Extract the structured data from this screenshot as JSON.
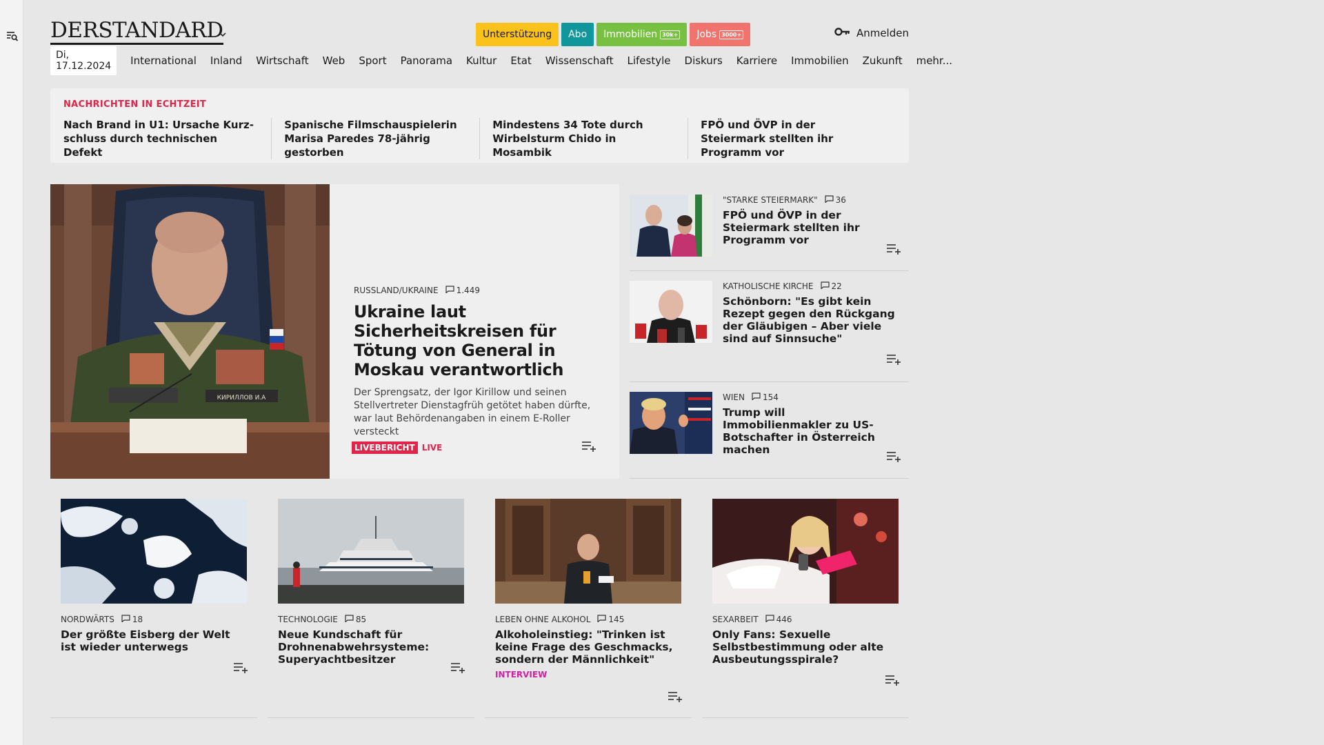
{
  "sidebar": {
    "menu_icon": "search-menu-icon"
  },
  "header": {
    "logo": "DERSTANDARD",
    "promo": {
      "support": "Unterstützung",
      "abo": "Abo",
      "immobilien": "Immobilien",
      "immobilien_badge": "30k+",
      "jobs": "Jobs",
      "jobs_badge": "3000+"
    },
    "login": "Anmelden",
    "colors": {
      "support": "#fbc21c",
      "abo": "#11969b",
      "immobilien": "#77c042",
      "jobs": "#f0746d",
      "accent": "#e0254a"
    }
  },
  "nav": {
    "date": "Di, 17.12.2024",
    "items": [
      "International",
      "Inland",
      "Wirtschaft",
      "Web",
      "Sport",
      "Panorama",
      "Kultur",
      "Etat",
      "Wissenschaft",
      "Lifestyle",
      "Diskurs",
      "Karriere",
      "Immobilien",
      "Zukunft",
      "mehr..."
    ]
  },
  "ticker": {
    "label": "NACHRICHTEN IN ECHTZEIT",
    "items": [
      "Nach Brand in U1: Ursache Kurz­schluss durch technischen Defekt",
      "Spanische Filmschauspielerin Marisa Paredes 78-jährig gestorben",
      "Mindestens 34 Tote durch Wirbel­sturm Chido in Mosambik",
      "FPÖ und ÖVP in der Steiermark stell­ten ihr Programm vor"
    ]
  },
  "lead": {
    "kicker": "RUSSLAND/UKRAINE",
    "comments": "1.449",
    "title": "Ukraine laut Sicherheitskrei­sen für Tötung von General in Moskau verantwortlich",
    "teaser": "Der Sprengsatz, der Igor Kirillow und seinen Stellvertreter Dienstagfrüh getötet haben dürfte, war laut Behördenangaben in einem E-Roller versteckt",
    "badge": "LIVEBERICHT",
    "live": "LIVE",
    "nameplate": "КИРИЛЛОВ И.А"
  },
  "side": [
    {
      "kicker": "\"STARKE STEIERMARK\"",
      "comments": "36",
      "title": "FPÖ und ÖVP in der Steiermark stellten ihr Programm vor"
    },
    {
      "kicker": "KATHOLISCHE KIRCHE",
      "comments": "22",
      "title": "Schönborn: \"Es gibt kein Rezept gegen den Rückgang der Gläubigen – Aber viele sind auf Sinnsuche\""
    },
    {
      "kicker": "WIEN",
      "comments": "154",
      "title": "Trump will Immobilienmakler zu US-Botschafter in Österreich machen"
    }
  ],
  "cards": [
    {
      "kicker": "NORDWÄRTS",
      "comments": "18",
      "title": "Der größte Eisberg der Welt ist wieder unterwegs"
    },
    {
      "kicker": "TECHNOLOGIE",
      "comments": "85",
      "title": "Neue Kundschaft für Drohnenab­wehrsysteme: Superyachtbesitzer"
    },
    {
      "kicker": "LEBEN OHNE ALKOHOL",
      "comments": "145",
      "title": "Alkoholeinstieg: \"Trinken ist keine Frage des Geschmacks, sondern der Männlichkeit\"",
      "tag": "INTERVIEW"
    },
    {
      "kicker": "SEXARBEIT",
      "comments": "446",
      "title": "Only Fans: Sexuelle Selbstbestim­mung oder alte Ausbeutungsspi­rale?"
    }
  ]
}
